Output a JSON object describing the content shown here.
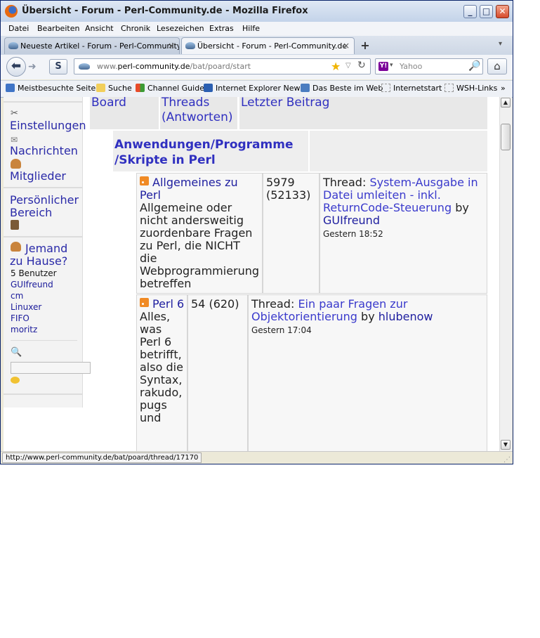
{
  "window": {
    "title": "Übersicht - Forum - Perl-Community.de - Mozilla Firefox",
    "minimize": "_",
    "maximize": "□",
    "close": "✕"
  },
  "menu": [
    "Datei",
    "Bearbeiten",
    "Ansicht",
    "Chronik",
    "Lesezeichen",
    "Extras",
    "Hilfe"
  ],
  "tabs": [
    {
      "label": "Neueste Artikel - Forum - Perl-Community...",
      "close": "×"
    },
    {
      "label": "Übersicht - Forum - Perl-Community.de",
      "close": "×"
    }
  ],
  "new_tab": "+",
  "nav": {
    "url_prefix": "www.",
    "url_domain": "perl-community.de",
    "url_path": "/bat/poard/start",
    "search_placeholder": "Yahoo",
    "s_button": "S"
  },
  "bookmarks": [
    "Meistbesuchte Seiten",
    "Suche",
    "Channel Guide",
    "Internet Explorer News",
    "Das Beste im Web",
    "Internetstart",
    "WSH-Links"
  ],
  "bookmarks_more": "»",
  "sidebar": {
    "settings": "Einstellungen",
    "messages": "Nachrichten",
    "members": "Mitglieder",
    "personal_area": "Persönlicher Bereich",
    "who_home": "Jemand zu Hause?",
    "users_count": "5 Benutzer",
    "users": [
      "GUIfreund",
      "cm",
      "Linuxer",
      "FIFO",
      "moritz"
    ]
  },
  "table": {
    "headers": {
      "board": "Board",
      "threads": "Threads (Antworten)",
      "last_post": "Letzter Beitrag"
    },
    "category": "Anwendungen/Programme /Skripte in Perl",
    "forums": [
      {
        "name": "Allgemeines zu Perl",
        "description": "Allgemeine oder nicht andersweitig zuordenbare Fragen zu Perl, die NICHT die Webprogrammierung betreffen",
        "threads": "5979 (52133)",
        "thread_prefix": "Thread:",
        "thread_title": "System-Ausgabe in Datei umleiten - inkl. ReturnCode-Steuerung",
        "by": "by",
        "author": "GUIfreund",
        "time": "Gestern 18:52"
      },
      {
        "name": "Perl 6",
        "description": "Alles, was Perl 6 betrifft, also die Syntax, rakudo, pugs und",
        "threads": "54 (620)",
        "thread_prefix": "Thread:",
        "thread_title": "Ein paar Fragen zur Objektorientierung",
        "by": "by",
        "author": "hlubenow",
        "time": "Gestern 17:04"
      }
    ]
  },
  "status": "http://www.perl-community.de/bat/poard/thread/17170"
}
